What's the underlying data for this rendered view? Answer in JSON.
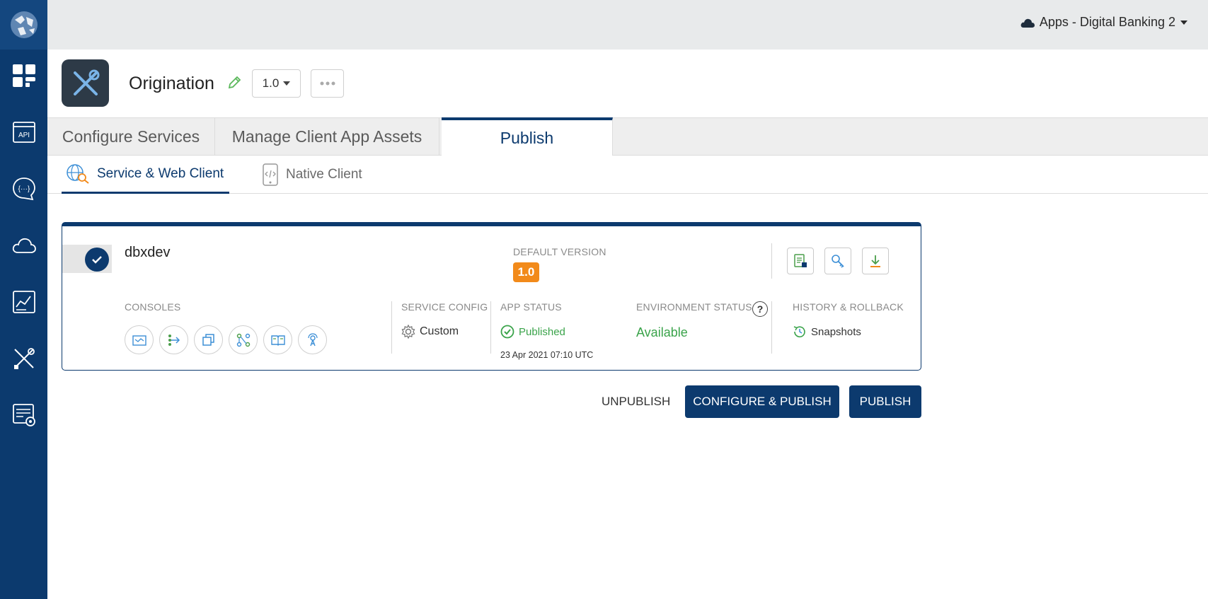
{
  "account": {
    "label": "Apps - Digital Banking 2"
  },
  "sidebar": {
    "items": [
      {
        "name": "dashboard-icon"
      },
      {
        "name": "api-icon",
        "text": "API"
      },
      {
        "name": "messaging-icon"
      },
      {
        "name": "cloud-icon"
      },
      {
        "name": "analytics-icon"
      },
      {
        "name": "tools-icon"
      },
      {
        "name": "engagement-icon"
      }
    ]
  },
  "app": {
    "name": "Origination",
    "version": "1.0"
  },
  "tabs": [
    {
      "label": "Configure Services"
    },
    {
      "label": "Manage Client App Assets"
    },
    {
      "label": "Publish",
      "active": true
    }
  ],
  "subtabs": [
    {
      "label": "Service & Web Client",
      "active": true
    },
    {
      "label": "Native Client"
    }
  ],
  "env": {
    "name": "dbxdev",
    "default_version_label": "DEFAULT VERSION",
    "default_version": "1.0",
    "consoles_label": "CONSOLES",
    "service_config_label": "SERVICE CONFIG",
    "service_config_value": "Custom",
    "app_status_label": "APP STATUS",
    "app_status_value": "Published",
    "app_status_time": "23 Apr 2021 07:10 UTC",
    "env_status_label": "ENVIRONMENT STATUS",
    "env_status_value": "Available",
    "help_glyph": "?",
    "history_label": "HISTORY & ROLLBACK",
    "history_value": "Snapshots"
  },
  "actions": {
    "unpublish": "UNPUBLISH",
    "configure_publish": "CONFIGURE & PUBLISH",
    "publish": "PUBLISH"
  },
  "colors": {
    "brand": "#0c3a6e",
    "accent_orange": "#f28a1a",
    "success_green": "#3aa34a"
  }
}
